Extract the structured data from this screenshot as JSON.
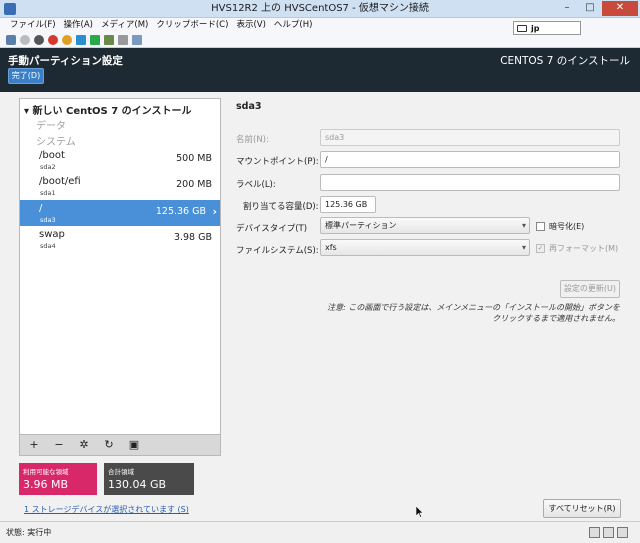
{
  "window": {
    "title": "HVS12R2 上の HVSCentOS7 - 仮想マシン接続"
  },
  "menu": [
    "ファイル(F)",
    "操作(A)",
    "メディア(M)",
    "クリップボード(C)",
    "表示(V)",
    "ヘルプ(H)"
  ],
  "header": {
    "title": "手動パーティション設定",
    "done_label": "完了(D)",
    "product": "CENTOS 7 のインストール",
    "keyboard": "jp"
  },
  "left": {
    "heading": "新しい CentOS 7 のインストール",
    "groups": [
      "データ",
      "システム"
    ],
    "partitions": [
      {
        "name": "/boot",
        "device": "sda2",
        "size": "500 MB"
      },
      {
        "name": "/boot/efi",
        "device": "sda1",
        "size": "200 MB"
      },
      {
        "name": "/",
        "device": "sda3",
        "size": "125.36 GB"
      },
      {
        "name": "swap",
        "device": "sda4",
        "size": "3.98 GB"
      }
    ],
    "selected": "/"
  },
  "capacity": {
    "available_label": "利用可能な領域",
    "available_value": "3.96 MB",
    "total_label": "合計領域",
    "total_value": "130.04 GB",
    "colors": {
      "available": "#d9286a",
      "total": "#4a4a4a"
    }
  },
  "storage_link": "1 ストレージデバイスが選択されています (S)",
  "detail": {
    "title": "sda3",
    "name_label": "名前(N):",
    "name_value": "sda3",
    "mount_label": "マウントポイント(P):",
    "mount_value": "/",
    "label_label": "ラベル(L):",
    "label_value": "",
    "capacity_label": "割り当てる容量(D):",
    "capacity_value": "125.36 GB",
    "device_type_label": "デバイスタイプ(T)",
    "device_type_value": "標準パーティション",
    "encrypt_label": "暗号化(E)",
    "fs_label": "ファイルシステム(S):",
    "fs_value": "xfs",
    "reformat_label": "再フォーマット(M)",
    "update_label": "設定の更新(U)",
    "note_line1": "注意: この画面で行う設定は、メインメニューの「インストールの開始」ボタンを",
    "note_line2": "クリックするまで適用されません。"
  },
  "reset_label": "すべてリセット(R)",
  "status": "状態: 実行中",
  "accent": "#4a90d9"
}
